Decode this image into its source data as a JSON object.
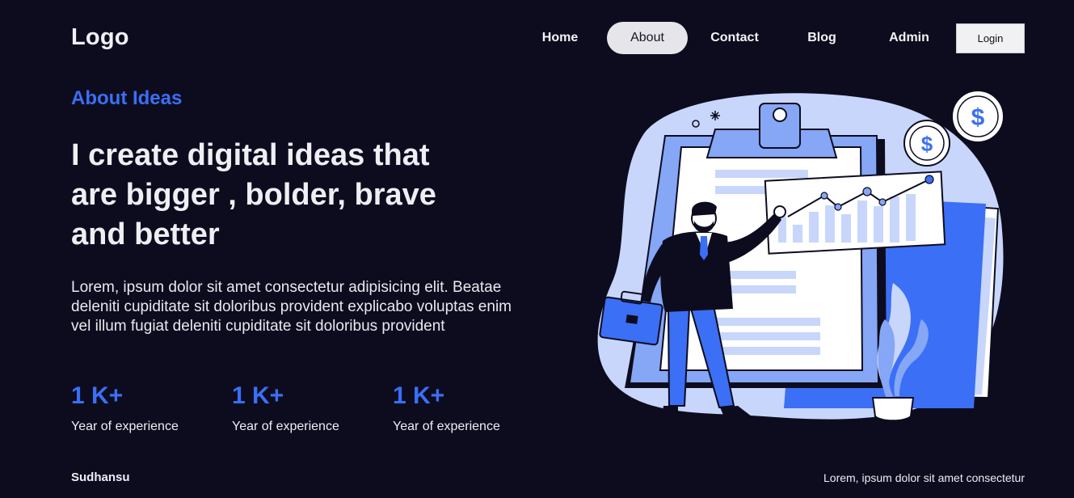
{
  "header": {
    "logo": "Logo",
    "nav": [
      {
        "label": "Home",
        "active": false
      },
      {
        "label": "About",
        "active": true
      },
      {
        "label": "Contact",
        "active": false
      },
      {
        "label": "Blog",
        "active": false
      },
      {
        "label": "Admin",
        "active": false
      }
    ],
    "login_label": "Login"
  },
  "hero": {
    "eyebrow": "About Ideas",
    "headline_lines": [
      "I create digital ideas that",
      "are bigger , bolder, brave",
      "and better"
    ],
    "description": "Lorem, ipsum dolor sit amet consectetur adipisicing elit. Beatae deleniti cupiditate sit doloribus provident explicabo voluptas enim vel illum fugiat deleniti cupiditate sit doloribus provident"
  },
  "stats": [
    {
      "value": "1 K+",
      "label": "Year of experience"
    },
    {
      "value": "1 K+",
      "label": "Year of experience"
    },
    {
      "value": "1 K+",
      "label": "Year of experience"
    }
  ],
  "footer": {
    "left": "Sudhansu",
    "right": "Lorem, ipsum dolor sit amet consectetur"
  },
  "illustration": {
    "coin_symbol": "$",
    "icons": [
      "clipboard-icon",
      "coin-icon",
      "chart-board-icon",
      "briefcase-icon",
      "plant-icon",
      "businessman-icon"
    ]
  },
  "colors": {
    "background": "#0d0c1f",
    "accent": "#3b6ff5",
    "text": "#eeeef3",
    "nav_active_bg": "#e6e6ea"
  }
}
